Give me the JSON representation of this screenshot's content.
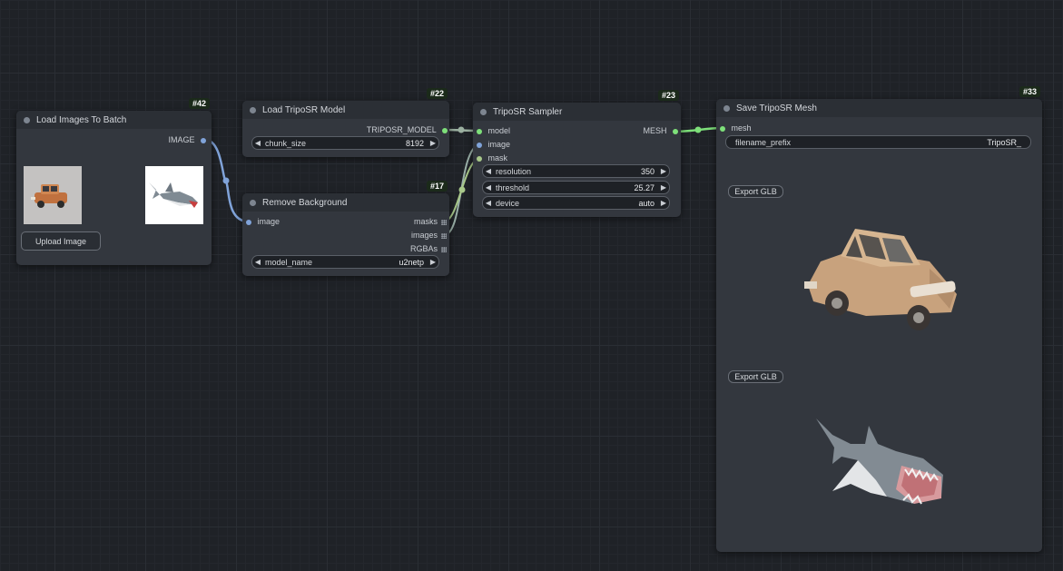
{
  "nodes": {
    "load_images": {
      "id": "#42",
      "title": "Load Images To Batch",
      "output": "IMAGE",
      "upload_label": "Upload Image",
      "thumbnails": [
        "toy car image",
        "shark image"
      ]
    },
    "load_model": {
      "id": "#22",
      "title": "Load TripoSR Model",
      "output": "TRIPOSR_MODEL",
      "widget": {
        "name": "chunk_size",
        "value": "8192"
      }
    },
    "remove_bg": {
      "id": "#17",
      "title": "Remove Background",
      "input": "image",
      "outputs": [
        "masks",
        "images",
        "RGBAs"
      ],
      "widget": {
        "name": "model_name",
        "value": "u2netp"
      }
    },
    "sampler": {
      "id": "#23",
      "title": "TripoSR Sampler",
      "inputs": [
        "model",
        "image",
        "mask"
      ],
      "output": "MESH",
      "widgets": [
        {
          "name": "resolution",
          "value": "350"
        },
        {
          "name": "threshold",
          "value": "25.27"
        },
        {
          "name": "device",
          "value": "auto"
        }
      ]
    },
    "save_mesh": {
      "id": "#33",
      "title": "Save TripoSR Mesh",
      "input": "mesh",
      "widget": {
        "name": "filename_prefix",
        "value": "TripoSR_"
      },
      "export_label": "Export GLB",
      "previews": [
        "3D car mesh preview",
        "3D shark mesh preview"
      ]
    }
  },
  "colors": {
    "background": "#1f2227",
    "node_body": "#33373e",
    "node_title": "#2b2f35",
    "image_link": "#80a3d9",
    "model_link": "#9bb0a0",
    "mask_link": "#a8c88a",
    "mesh_link": "#7ee07a"
  }
}
